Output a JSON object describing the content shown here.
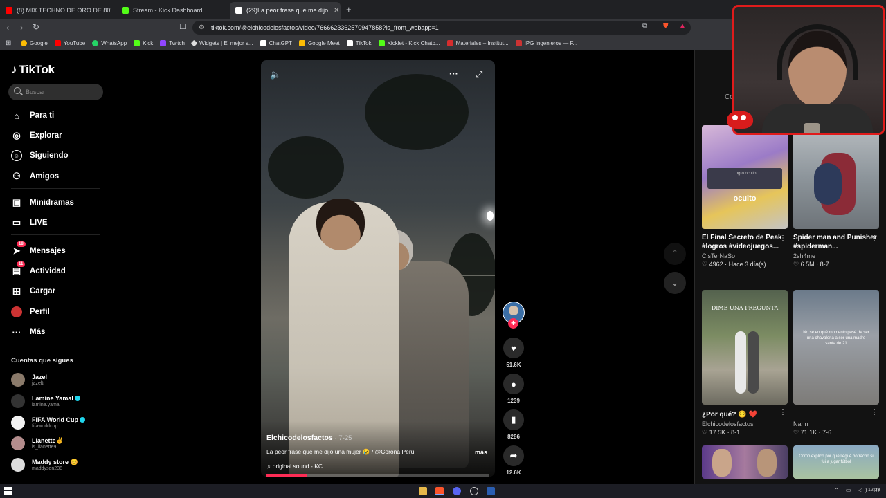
{
  "browser": {
    "tabs": [
      {
        "title": "(8) MIX TECHNO DE ORO DE 80's &",
        "color": "#ff0000"
      },
      {
        "title": "Stream - Kick Dashboard",
        "color": "#53fc18"
      },
      {
        "title": "(29)La peor frase que me dijo",
        "color": "#ffffff",
        "active": true
      }
    ],
    "url": "tiktok.com/@elchicodelosfactos/video/7666623362570947858?is_from_webapp=1",
    "bookmarks": [
      {
        "label": "Google",
        "color": "#fbbc05"
      },
      {
        "label": "YouTube",
        "color": "#ff0000"
      },
      {
        "label": "WhatsApp",
        "color": "#25d366"
      },
      {
        "label": "Kick",
        "color": "#53fc18"
      },
      {
        "label": "Twitch",
        "color": "#9146ff"
      },
      {
        "label": "Widgets | El mejor s...",
        "color": "#dddddd"
      },
      {
        "label": "ChatGPT",
        "color": "#ffffff"
      },
      {
        "label": "Google Meet",
        "color": "#fbbc05"
      },
      {
        "label": "TikTok",
        "color": "#ffffff"
      },
      {
        "label": "Kicklet - Kick Chatb...",
        "color": "#53fc18"
      },
      {
        "label": "Materiales – Institut...",
        "color": "#d62d2d"
      },
      {
        "label": "IPG Ingenieros — F...",
        "color": "#cc3333"
      }
    ]
  },
  "sidebar": {
    "logo": "TikTok",
    "search_placeholder": "Buscar",
    "nav": [
      {
        "label": "Para ti",
        "icon": "home-icon"
      },
      {
        "label": "Explorar",
        "icon": "compass-icon"
      },
      {
        "label": "Siguiendo",
        "icon": "following-icon"
      },
      {
        "label": "Amigos",
        "icon": "friends-icon"
      },
      {
        "label": "Minidramas",
        "icon": "minidrama-icon"
      },
      {
        "label": "LIVE",
        "icon": "live-icon"
      },
      {
        "label": "Mensajes",
        "icon": "messages-icon",
        "badge": "18"
      },
      {
        "label": "Actividad",
        "icon": "activity-icon",
        "badge": "11"
      },
      {
        "label": "Cargar",
        "icon": "upload-icon"
      },
      {
        "label": "Perfil",
        "icon": "profile-icon"
      },
      {
        "label": "Más",
        "icon": "more-icon"
      }
    ],
    "following_title": "Cuentas que sigues",
    "following": [
      {
        "name": "Jazel",
        "handle": "jazeltr",
        "color": "#8a7a6a"
      },
      {
        "name": "Lamine Yamal",
        "handle": "lamine.yamal",
        "verified": true,
        "color": "#333333"
      },
      {
        "name": "FIFA World Cup",
        "handle": "fifaworldcup",
        "verified": true,
        "color": "#f2f2f2"
      },
      {
        "name": "Lianette✌️",
        "handle": "is_lianette9",
        "color": "#b38c8c"
      },
      {
        "name": "Maddy store 😊",
        "handle": "maddyson238",
        "color": "#dddddd"
      }
    ]
  },
  "video": {
    "author": "Elchicodelosfactos",
    "date": "· 7-25",
    "caption": "La peor frase que me dijo una mujer 😢 / @Corona Perú",
    "more": "más",
    "sound": "♫  original sound - KC",
    "progress": 0.18
  },
  "actions": {
    "likes": "51.6K",
    "comments": "1239",
    "saves": "8286",
    "shares": "12.6K"
  },
  "right_panel": {
    "header": "Co",
    "cards": [
      {
        "title": "El Final Secreto de Peak #logros #videojuegos...",
        "user": "CisTerNaSo",
        "stats": "♡ 4962 · Hace 3 día(s)",
        "thumb_text": "oculto",
        "thumb_top": "Logro oculto"
      },
      {
        "title": "Spider man and Punisher #spiderman...",
        "user": "2sh4me",
        "stats": "♡ 6.5M · 8-7",
        "thumb_text": "",
        "thumb_top": ""
      },
      {
        "title": "¿Por qué? 😔 ❤️",
        "user": "Elchicodelosfactos",
        "stats": "♡ 17.5K · 8-1",
        "thumb_text": "DIME UNA PREGUNTA",
        "thumb_top": ""
      },
      {
        "title": "",
        "user": "Nann",
        "stats": "♡ 71.1K · 7-6",
        "thumb_text": "No sé en qué momento pasé de ser una chavalona a ser una madre santa de 21",
        "thumb_top": ""
      },
      {
        "title": "",
        "user": "",
        "stats": "",
        "thumb_text": "",
        "thumb_top": ""
      },
      {
        "title": "",
        "user": "",
        "stats": "",
        "thumb_text": "Como explico por qué llegué borracho si fui a jugar fútbol",
        "thumb_top": ""
      }
    ]
  },
  "taskbar": {
    "clock": "12:38",
    "tray": "⌃ ▭ ◁) ◫"
  },
  "colors": {
    "accent": "#fe2c55",
    "cam_border": "#e01b1b"
  }
}
